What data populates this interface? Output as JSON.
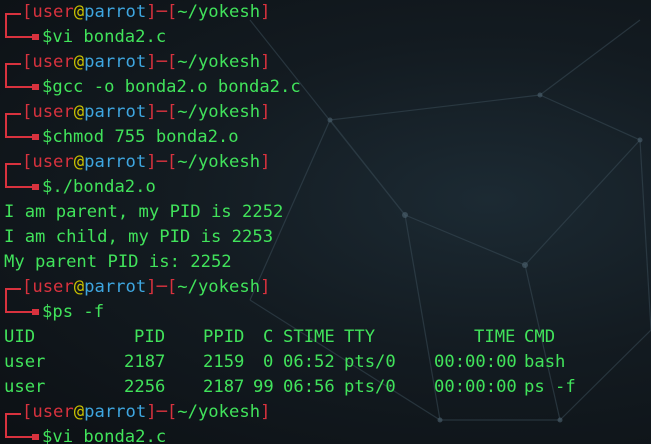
{
  "prompt": {
    "user": "user",
    "at": "@",
    "host": "parrot",
    "dir": "~/yokesh",
    "dollar": "$"
  },
  "commands": [
    "vi bonda2.c",
    "gcc -o bonda2.o bonda2.c",
    "chmod 755 bonda2.o",
    "./bonda2.o",
    "ps -f",
    "vi bonda2.c"
  ],
  "program_output": [
    "I am parent, my PID is 2252",
    "I am child, my PID is 2253",
    "My parent PID is: 2252"
  ],
  "ps_table": {
    "columns": [
      "UID",
      "PID",
      "PPID",
      "C",
      "STIME",
      "TTY",
      "TIME",
      "CMD"
    ],
    "rows": [
      [
        "user",
        "2187",
        "2159",
        "0",
        "06:52",
        "pts/0",
        "00:00:00",
        "bash"
      ],
      [
        "user",
        "2256",
        "2187",
        "99",
        "06:56",
        "pts/0",
        "00:00:00",
        "ps -f"
      ]
    ]
  },
  "colors": {
    "text_green": "#41e35b",
    "prompt_red": "#d8323e",
    "host_blue": "#3ea6e0",
    "at_yellow": "#c9c100",
    "background": "#131b21"
  }
}
